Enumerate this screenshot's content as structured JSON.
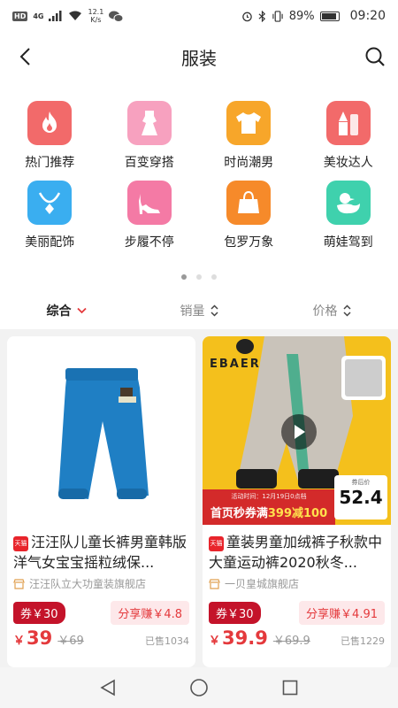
{
  "status_bar": {
    "hd": "HD",
    "network": "4G",
    "net_speed_top": "12.1",
    "net_speed_bottom": "K/s",
    "battery": "89%",
    "time": "09:20"
  },
  "header": {
    "title": "服装"
  },
  "categories": [
    {
      "label": "热门推荐",
      "icon": "flame-icon",
      "color": "#f26a6a"
    },
    {
      "label": "百变穿搭",
      "icon": "dress-icon",
      "color": "#f7a1bf"
    },
    {
      "label": "时尚潮男",
      "icon": "tshirt-icon",
      "color": "#f7a62a"
    },
    {
      "label": "美妆达人",
      "icon": "lipstick-icon",
      "color": "#f26a6a"
    },
    {
      "label": "美丽配饰",
      "icon": "necklace-icon",
      "color": "#3aaef0"
    },
    {
      "label": "步履不停",
      "icon": "high-heel-icon",
      "color": "#f47aa5"
    },
    {
      "label": "包罗万象",
      "icon": "handbag-icon",
      "color": "#f68a2a"
    },
    {
      "label": "萌娃驾到",
      "icon": "duck-icon",
      "color": "#3fd1ad"
    }
  ],
  "sort": [
    {
      "label": "综合",
      "active": true
    },
    {
      "label": "销量",
      "active": false
    },
    {
      "label": "价格",
      "active": false
    }
  ],
  "products": [
    {
      "badge": "天猫",
      "title": "汪汪队儿童长裤男童韩版洋气女宝宝摇粒绒保...",
      "shop": "汪汪队立大功童装旗舰店",
      "coupon": "券￥30",
      "share": "分享赚￥4.8",
      "yen": "￥",
      "price": "39",
      "original_price": "￥69",
      "sold": "已售1034"
    },
    {
      "badge": "天猫",
      "title": "童装男童加绒裤子秋款中大童运动裤2020秋冬...",
      "shop": "一贝皇城旗舰店",
      "coupon": "券￥30",
      "share": "分享赚￥4.91",
      "yen": "￥",
      "price": "39.9",
      "original_price": "￥69.9",
      "sold": "已售1229",
      "image_text": {
        "brand": "EBAER",
        "promo_small": "活动时间：12月19日0点档",
        "promo_main_prefix": "首页秒券满",
        "promo_main_highlight": "399减100",
        "price_tag_label": "券后价",
        "price_tag_price": "52.4"
      }
    }
  ]
}
